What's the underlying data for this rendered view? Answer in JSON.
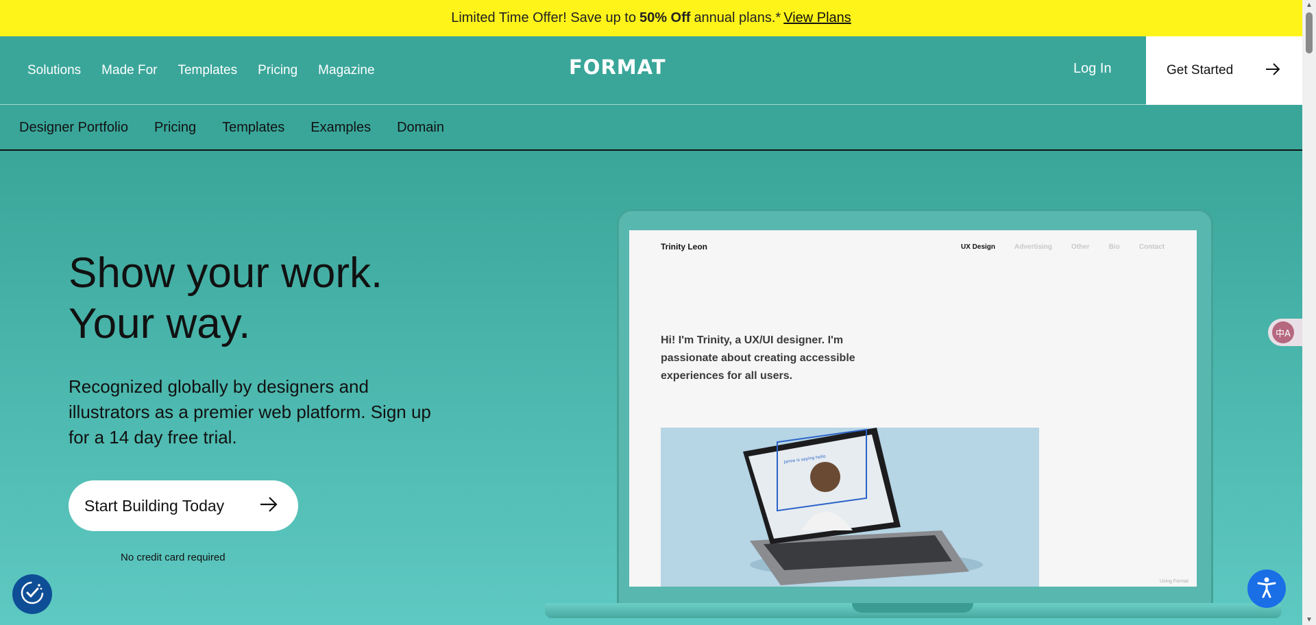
{
  "promo": {
    "text_before": "Limited Time Offer! Save up to",
    "highlight": "50% Off",
    "text_after": "annual plans.*",
    "link": "View Plans"
  },
  "header": {
    "nav": [
      "Solutions",
      "Made For",
      "Templates",
      "Pricing",
      "Magazine"
    ],
    "logo": "FORMAT",
    "login": "Log In",
    "get_started": "Get Started"
  },
  "subnav": [
    "Designer Portfolio",
    "Pricing",
    "Templates",
    "Examples",
    "Domain"
  ],
  "hero": {
    "title_line1": "Show your work.",
    "title_line2": "Your way.",
    "description": "Recognized globally by designers and illustrators as a premier web platform. Sign up for a 14 day free trial.",
    "cta": "Start Building Today",
    "note": "No credit card required"
  },
  "portfolio": {
    "name": "Trinity Leon",
    "nav": [
      "UX Design",
      "Advertising",
      "Other",
      "Bio",
      "Contact"
    ],
    "intro": "Hi! I'm Trinity, a UX/UI designer. I'm passionate about creating accessible experiences for all users.",
    "inner_tag": "Jamie is saying hello",
    "watermark": "Using Format"
  },
  "widgets": {
    "translate_glyph": "中A"
  },
  "colors": {
    "banner": "#fff41a",
    "header_teal": "#3aa69a",
    "hero_bottom": "#5ec9c2",
    "accessibility_blue": "#1a6ee6",
    "consent_navy": "#0e4e96"
  }
}
